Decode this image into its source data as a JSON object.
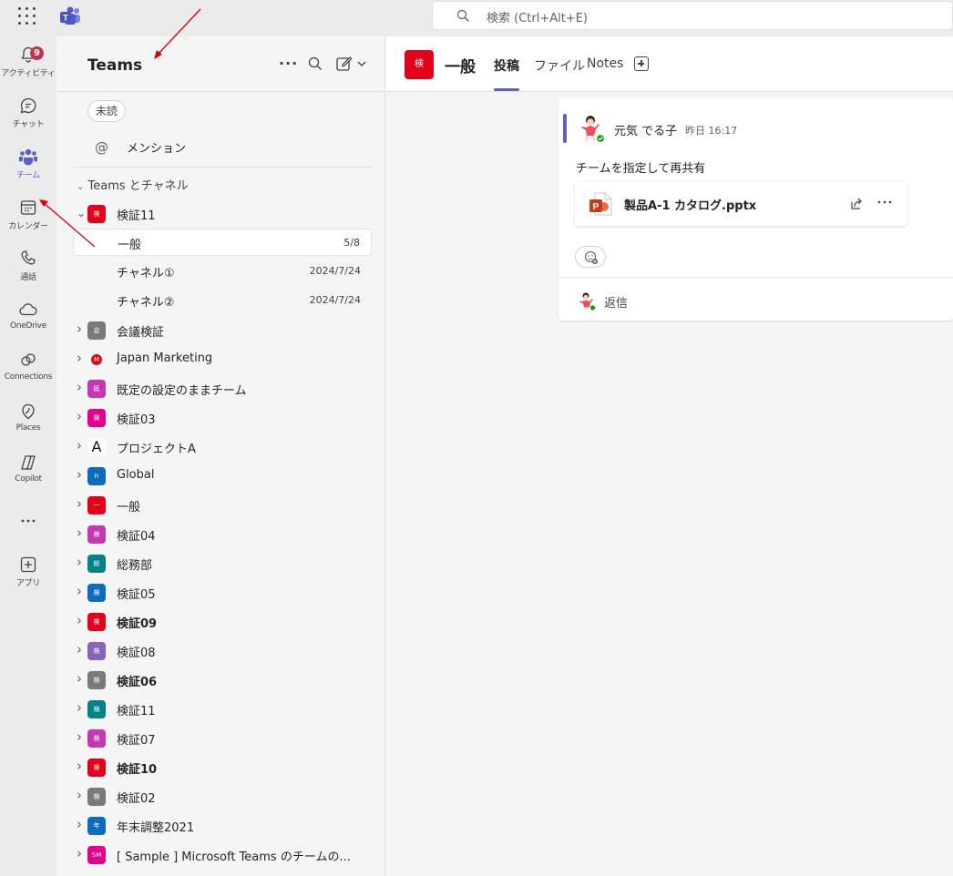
{
  "topbar": {
    "search_placeholder": "検索 (Ctrl+Alt+E)"
  },
  "rail": [
    {
      "label": "アクティビティ",
      "icon": "bell-icon",
      "badge": "9"
    },
    {
      "label": "チャット",
      "icon": "chat-icon"
    },
    {
      "label": "チーム",
      "icon": "teams-icon",
      "active": true
    },
    {
      "label": "カレンダー",
      "icon": "calendar-icon"
    },
    {
      "label": "通話",
      "icon": "phone-icon"
    },
    {
      "label": "OneDrive",
      "icon": "cloud-icon"
    },
    {
      "label": "Connections",
      "icon": "connections-icon"
    },
    {
      "label": "Places",
      "icon": "places-icon"
    },
    {
      "label": "Copilot",
      "icon": "copilot-icon"
    },
    {
      "label": "",
      "icon": "more-icon"
    },
    {
      "label": "アプリ",
      "icon": "apps-add-icon"
    }
  ],
  "pane": {
    "title": "Teams",
    "filter_chip": "未読",
    "mention": "メンション",
    "section": "Teams とチャネル",
    "expanded_team": {
      "name": "検証11",
      "avatar": "検",
      "color": "#e3001b"
    },
    "channels": [
      {
        "name": "一般",
        "meta": "5/8",
        "selected": true
      },
      {
        "name": "チャネル①",
        "meta": "2024/7/24"
      },
      {
        "name": "チャネル②",
        "meta": "2024/7/24"
      }
    ],
    "teams": [
      {
        "name": "会議検証",
        "avatar": "会",
        "color": "#7a7a7a"
      },
      {
        "name": "Japan Marketing",
        "avatar": "M",
        "color": "#e3001b"
      },
      {
        "name": "既定の設定のままチーム",
        "avatar": "既",
        "color": "#c239b3"
      },
      {
        "name": "検証03",
        "avatar": "検",
        "color": "#e3008c"
      },
      {
        "name": "プロジェクトA",
        "avatar": "A",
        "color": "#ffffff"
      },
      {
        "name": "Global",
        "avatar": "h",
        "color": "#0f6cbd"
      },
      {
        "name": "一般",
        "avatar": "一",
        "color": "#e3001b"
      },
      {
        "name": "検証04",
        "avatar": "検",
        "color": "#c239b3"
      },
      {
        "name": "総務部",
        "avatar": "総",
        "color": "#038387"
      },
      {
        "name": "検証05",
        "avatar": "検",
        "color": "#0f6cbd"
      },
      {
        "name": "検証09",
        "avatar": "検",
        "color": "#e3001b",
        "bold": true
      },
      {
        "name": "検証08",
        "avatar": "検",
        "color": "#8764b8"
      },
      {
        "name": "検証06",
        "avatar": "検",
        "color": "#7a7a7a",
        "bold": true
      },
      {
        "name": "検証11",
        "avatar": "検",
        "color": "#038387"
      },
      {
        "name": "検証07",
        "avatar": "検",
        "color": "#c239b3"
      },
      {
        "name": "検証10",
        "avatar": "検",
        "color": "#e3001b",
        "bold": true
      },
      {
        "name": "検証02",
        "avatar": "検",
        "color": "#7a7a7a"
      },
      {
        "name": "年末調整2021",
        "avatar": "年",
        "color": "#0f6cbd"
      },
      {
        "name": "[ Sample ] Microsoft Teams のチームの...",
        "avatar": "SM",
        "color": "#e3008c"
      }
    ]
  },
  "main": {
    "channel_avatar": "検",
    "channel_name": "一般",
    "tabs": [
      "投稿",
      "ファイル",
      "Notes"
    ],
    "post": {
      "author": "元気 でる子",
      "time": "昨日 16:17",
      "text": "チームを指定して再共有",
      "file_name": "製品A-1 カタログ.pptx",
      "reply_label": "返信"
    }
  },
  "colors": {
    "accent": "#5b5fc7",
    "badge": "#c4314b",
    "annotation_arrow": "#e00000"
  }
}
